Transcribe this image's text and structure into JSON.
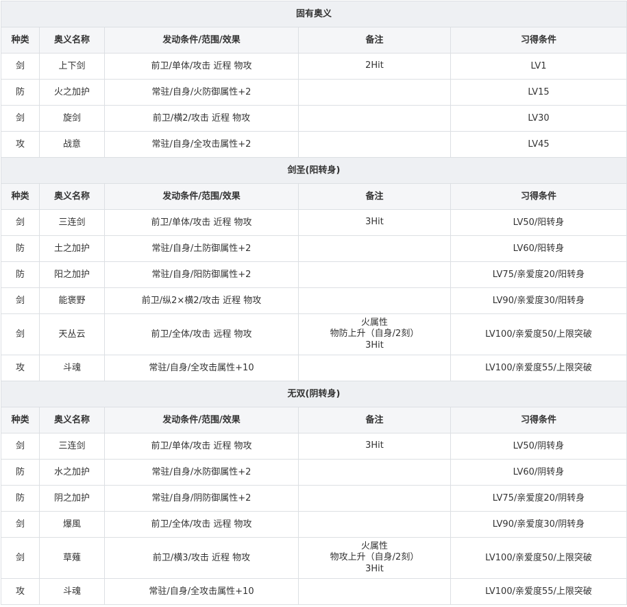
{
  "headers": [
    "种类",
    "奥义名称",
    "发动条件/范围/效果",
    "备注",
    "习得条件"
  ],
  "sections": [
    {
      "title": "固有奥义",
      "rows": [
        {
          "type": "剑",
          "name": "上下剑",
          "effect": "前卫/单体/攻击 近程 物攻",
          "note": [
            "2Hit"
          ],
          "learn": "LV1"
        },
        {
          "type": "防",
          "name": "火之加护",
          "effect": "常驻/自身/火防御属性+2",
          "note": [],
          "learn": "LV15"
        },
        {
          "type": "剑",
          "name": "旋剑",
          "effect": "前卫/横2/攻击 近程 物攻",
          "note": [],
          "learn": "LV30"
        },
        {
          "type": "攻",
          "name": "战意",
          "effect": "常驻/自身/全攻击属性+2",
          "note": [],
          "learn": "LV45"
        }
      ]
    },
    {
      "title": "剑圣(阳转身)",
      "rows": [
        {
          "type": "剑",
          "name": "三连剑",
          "effect": "前卫/单体/攻击 近程 物攻",
          "note": [
            "3Hit"
          ],
          "learn": "LV50/阳转身"
        },
        {
          "type": "防",
          "name": "土之加护",
          "effect": "常驻/自身/土防御属性+2",
          "note": [],
          "learn": "LV60/阳转身"
        },
        {
          "type": "防",
          "name": "阳之加护",
          "effect": "常驻/自身/阳防御属性+2",
          "note": [],
          "learn": "LV75/亲爱度20/阳转身"
        },
        {
          "type": "剑",
          "name": "能褒野",
          "effect": "前卫/纵2×横2/攻击 近程 物攻",
          "note": [],
          "learn": "LV90/亲爱度30/阳转身"
        },
        {
          "type": "剑",
          "name": "天丛云",
          "effect": "前卫/全体/攻击 远程 物攻",
          "note": [
            "火属性",
            "物防上升（自身/2刻）",
            "3Hit"
          ],
          "learn": "LV100/亲爱度50/上限突破"
        },
        {
          "type": "攻",
          "name": "斗魂",
          "effect": "常驻/自身/全攻击属性+10",
          "note": [],
          "learn": "LV100/亲爱度55/上限突破"
        }
      ]
    },
    {
      "title": "无双(阴转身)",
      "rows": [
        {
          "type": "剑",
          "name": "三连剑",
          "effect": "前卫/单体/攻击 近程 物攻",
          "note": [
            "3Hit"
          ],
          "learn": "LV50/阴转身"
        },
        {
          "type": "防",
          "name": "水之加护",
          "effect": "常驻/自身/水防御属性+2",
          "note": [],
          "learn": "LV60/阴转身"
        },
        {
          "type": "防",
          "name": "阴之加护",
          "effect": "常驻/自身/阴防御属性+2",
          "note": [],
          "learn": "LV75/亲爱度20/阴转身"
        },
        {
          "type": "剑",
          "name": "爆風",
          "effect": "前卫/全体/攻击 远程 物攻",
          "note": [],
          "learn": "LV90/亲爱度30/阴转身"
        },
        {
          "type": "剑",
          "name": "草薙",
          "effect": "前卫/横3/攻击 近程 物攻",
          "note": [
            "火属性",
            "物攻上升（自身/2刻）",
            "3Hit"
          ],
          "learn": "LV100/亲爱度50/上限突破"
        },
        {
          "type": "攻",
          "name": "斗魂",
          "effect": "常驻/自身/全攻击属性+10",
          "note": [],
          "learn": "LV100/亲爱度55/上限突破"
        }
      ]
    }
  ]
}
